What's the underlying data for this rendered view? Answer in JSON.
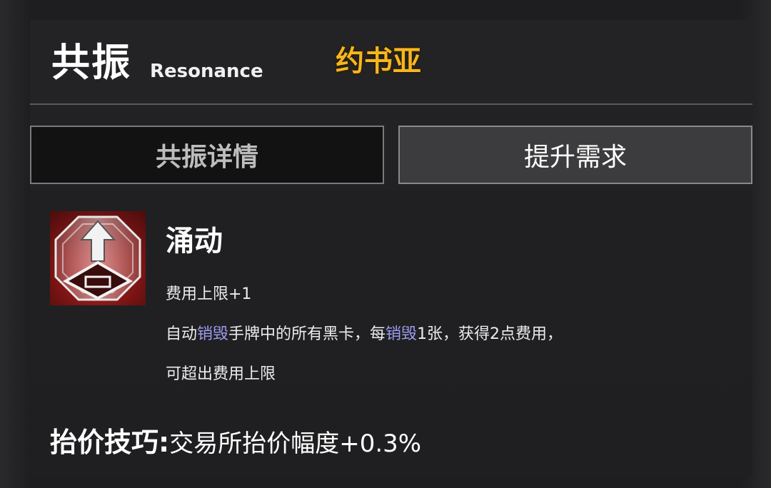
{
  "header": {
    "title_cn": "共振",
    "title_en": "Resonance",
    "character_name": "约书亚"
  },
  "tabs": [
    {
      "label": "共振详情",
      "active": true
    },
    {
      "label": "提升需求",
      "active": false
    }
  ],
  "skill": {
    "icon": "upward-arrow-crest-icon",
    "name": "涌动",
    "line1": "费用上限+1",
    "line2": {
      "p1": "自动",
      "kw1": "销毁",
      "p2": "手牌中的所有黑卡，每",
      "kw2": "销毁",
      "p3": "1张，获得2点费用，"
    },
    "line3": "可超出费用上限"
  },
  "bonus": {
    "label": "抬价技巧:",
    "text": "交易所抬价幅度+0.3%"
  },
  "colors": {
    "accent_gold": "#f6b622",
    "keyword": "#9e9cf0",
    "icon_red": "#c43030"
  }
}
